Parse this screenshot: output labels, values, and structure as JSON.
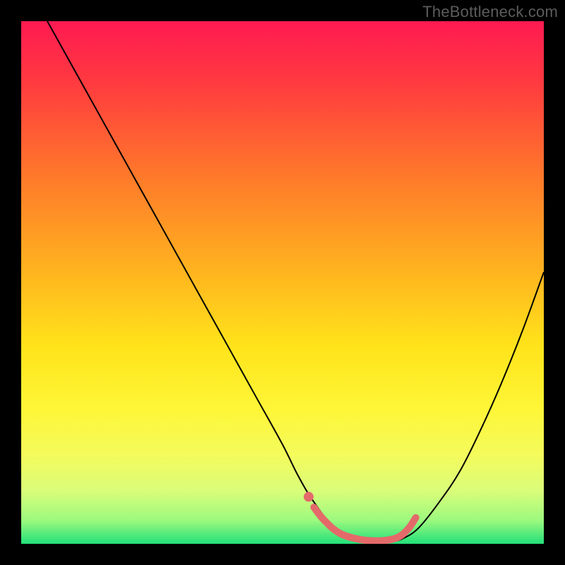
{
  "watermark": "TheBottleneck.com",
  "chart_data": {
    "type": "line",
    "title": "",
    "xlabel": "",
    "ylabel": "",
    "xlim": [
      0,
      100
    ],
    "ylim": [
      0,
      100
    ],
    "grid": false,
    "legend": false,
    "background_gradient_stops": [
      {
        "offset": 0.0,
        "color": "#ff1a52"
      },
      {
        "offset": 0.12,
        "color": "#ff3b3f"
      },
      {
        "offset": 0.3,
        "color": "#ff7a2a"
      },
      {
        "offset": 0.48,
        "color": "#ffb41f"
      },
      {
        "offset": 0.62,
        "color": "#ffe31a"
      },
      {
        "offset": 0.74,
        "color": "#fef636"
      },
      {
        "offset": 0.83,
        "color": "#f4fb5c"
      },
      {
        "offset": 0.9,
        "color": "#d9fd7a"
      },
      {
        "offset": 0.955,
        "color": "#9cf97e"
      },
      {
        "offset": 1.0,
        "color": "#22e07a"
      }
    ],
    "series": [
      {
        "name": "bottleneck-curve",
        "color": "#000000",
        "width": 2,
        "x": [
          5,
          10,
          15,
          20,
          25,
          30,
          35,
          40,
          45,
          50,
          53,
          56,
          60,
          64,
          68,
          71,
          73,
          76,
          80,
          84,
          88,
          92,
          96,
          100
        ],
        "y": [
          100,
          91,
          82,
          73,
          64,
          55,
          46,
          37,
          28,
          19,
          13,
          8,
          3,
          1,
          0.5,
          0.5,
          1,
          3,
          8,
          14,
          22,
          31,
          41,
          52
        ]
      },
      {
        "name": "highlight-band",
        "color": "#e46a6a",
        "width": 10,
        "linecap": "round",
        "x": [
          56,
          58,
          61,
          65,
          69,
          72,
          74,
          75.5
        ],
        "y": [
          7,
          4.5,
          2,
          0.8,
          0.6,
          1.2,
          2.8,
          5
        ]
      },
      {
        "name": "highlight-dot",
        "color": "#e46a6a",
        "type_hint": "scatter",
        "radius": 7,
        "x": [
          55
        ],
        "y": [
          9
        ]
      }
    ]
  }
}
